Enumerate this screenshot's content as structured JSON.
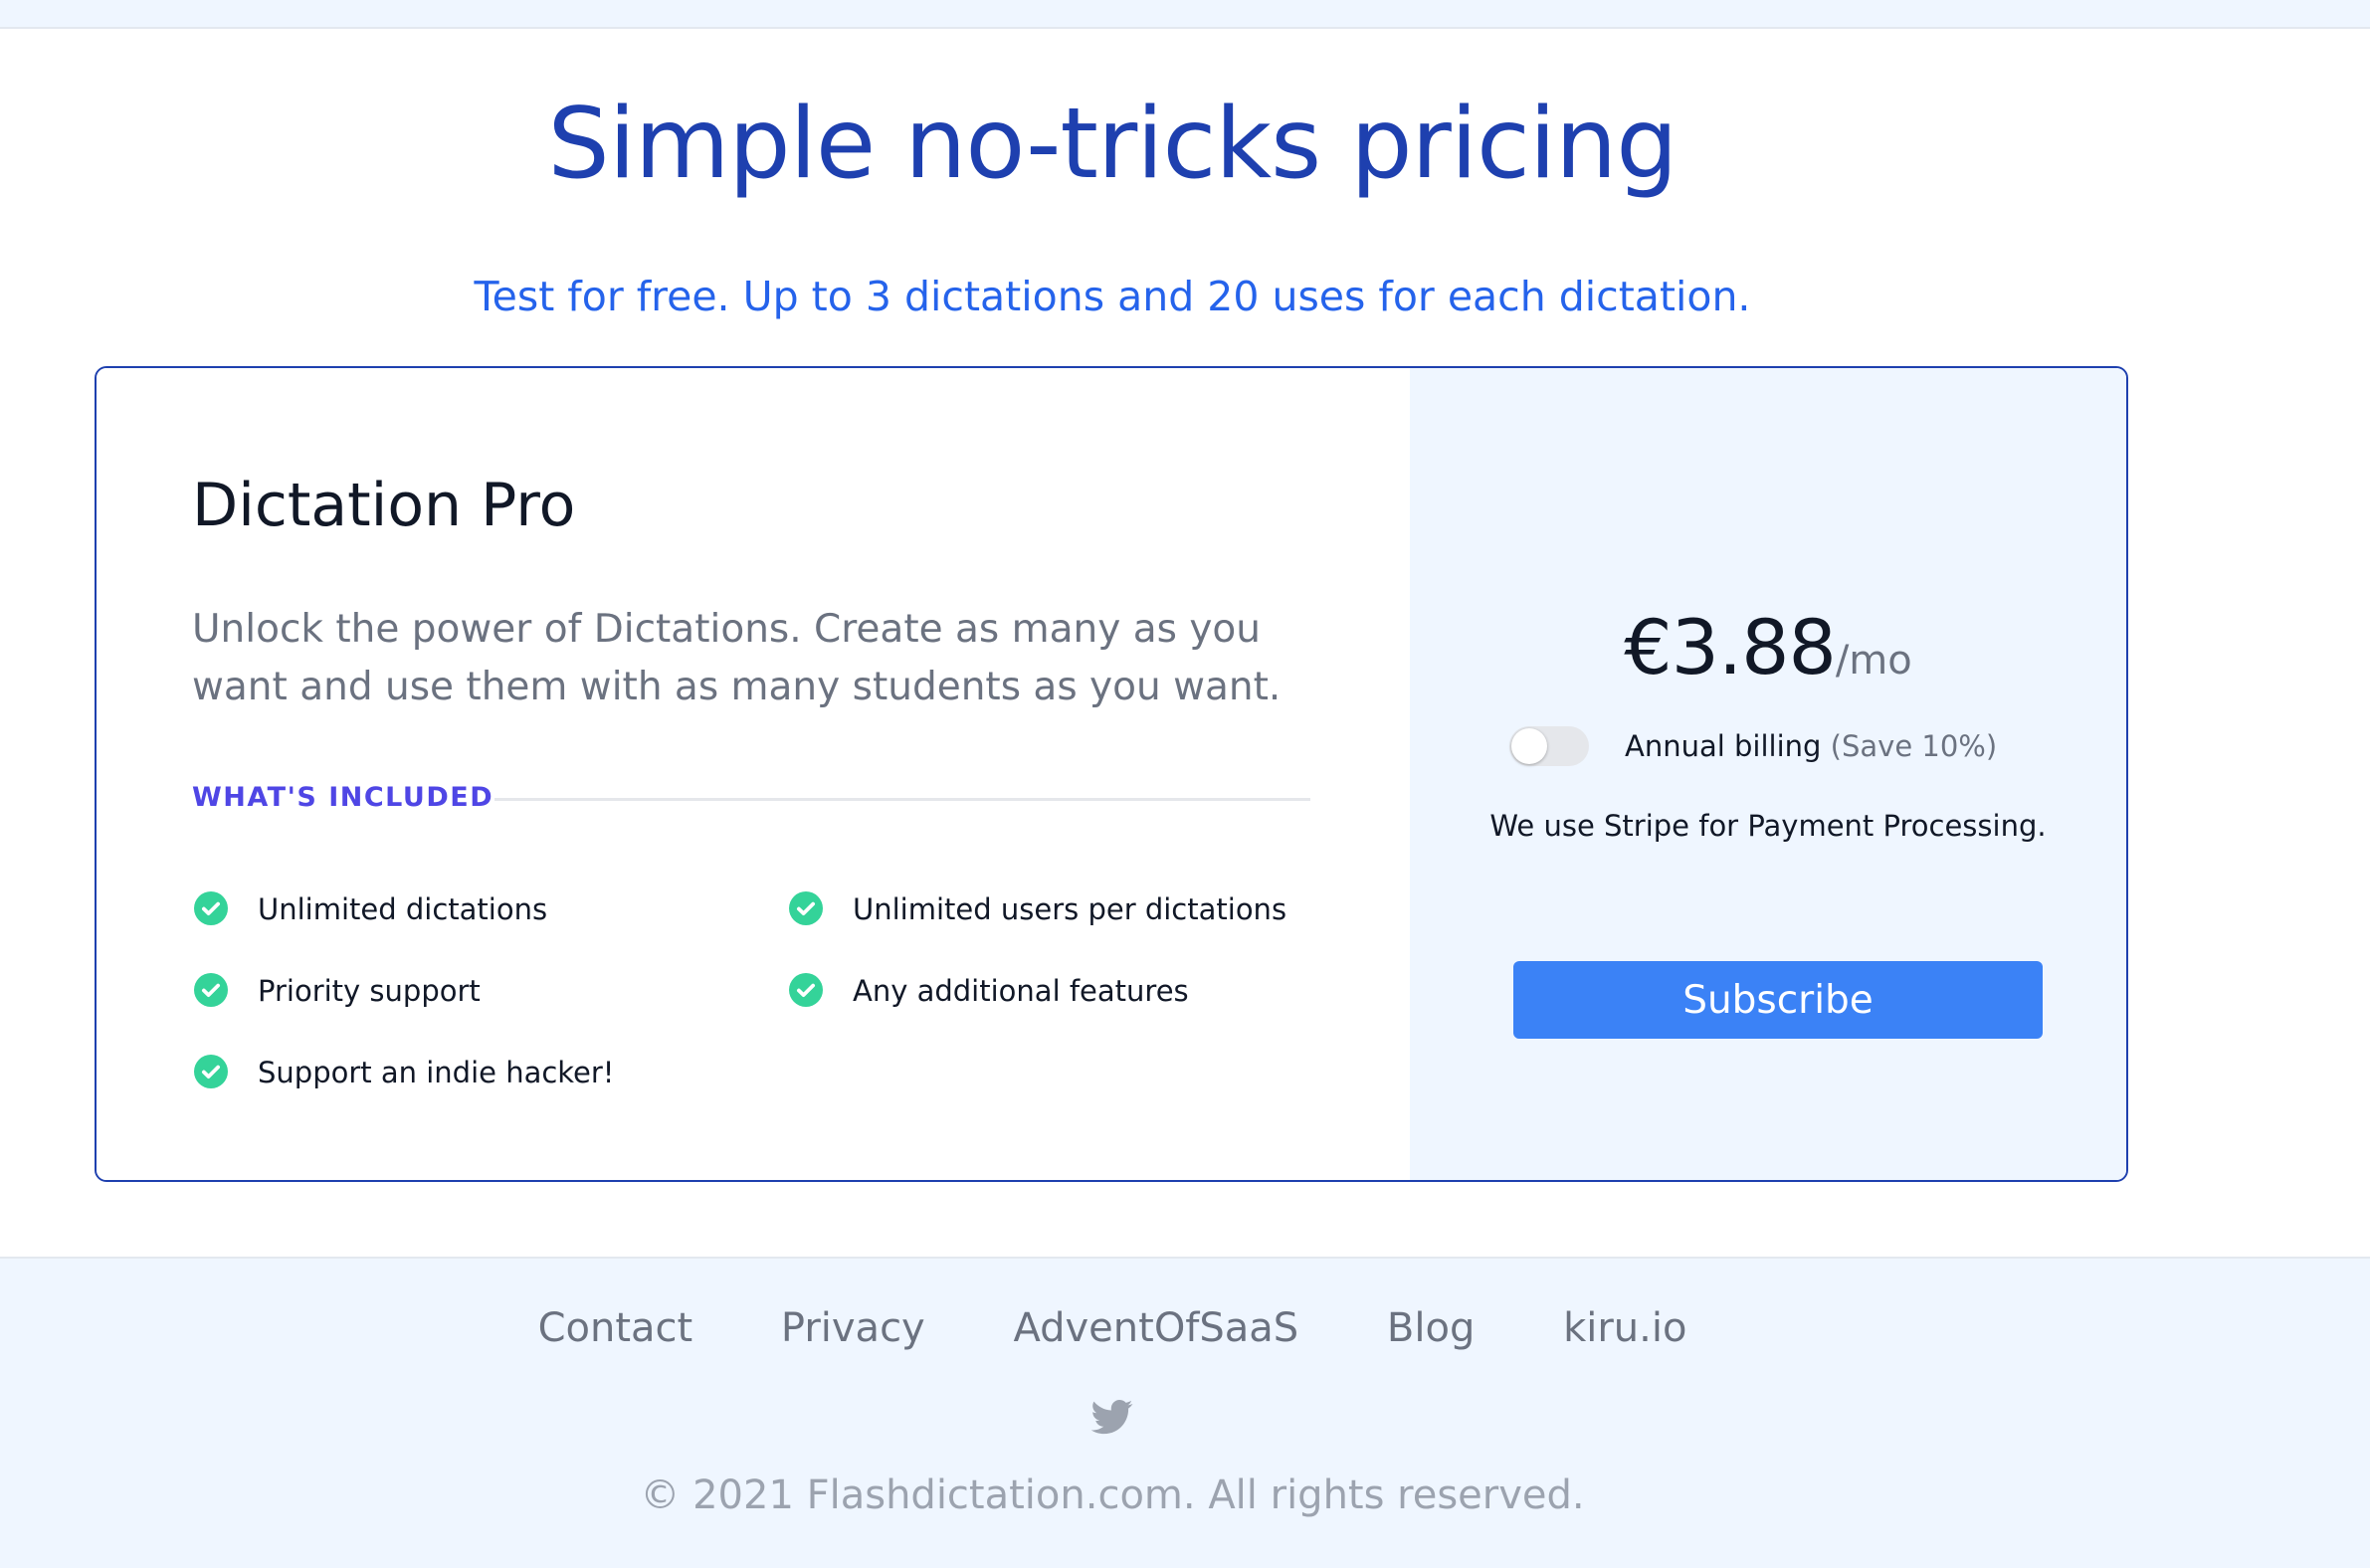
{
  "header": {
    "title": "Simple no-tricks pricing",
    "subtitle": "Test for free. Up to 3 dictations and 20 uses for each dictation."
  },
  "plan": {
    "name": "Dictation Pro",
    "description": "Unlock the power of Dictations. Create as many as you want and use them with as many students as you want.",
    "included_label": "WHAT'S INCLUDED",
    "features": [
      "Unlimited dictations",
      "Unlimited users per dictations",
      "Priority support",
      "Any additional features",
      "Support an indie hacker!"
    ],
    "feature_icon": "check-circle-icon"
  },
  "pricing": {
    "price": "€3.88",
    "period": "/mo",
    "annual_billing_label": "Annual billing",
    "annual_savings": "(Save 10%)",
    "annual_billing_enabled": false,
    "stripe_note": "We use Stripe for Payment Processing.",
    "subscribe_label": "Subscribe"
  },
  "footer": {
    "links": [
      "Contact",
      "Privacy",
      "AdventOfSaaS",
      "Blog",
      "kiru.io"
    ],
    "social_icon": "twitter-icon",
    "copyright": "© 2021 Flashdictation.com. All rights reserved."
  },
  "colors": {
    "heading": "#1e40af",
    "subheading": "#2563eb",
    "accent": "#4f46e5",
    "check": "#34d399",
    "button": "#3b82f6",
    "panel_bg": "#eff6ff"
  }
}
